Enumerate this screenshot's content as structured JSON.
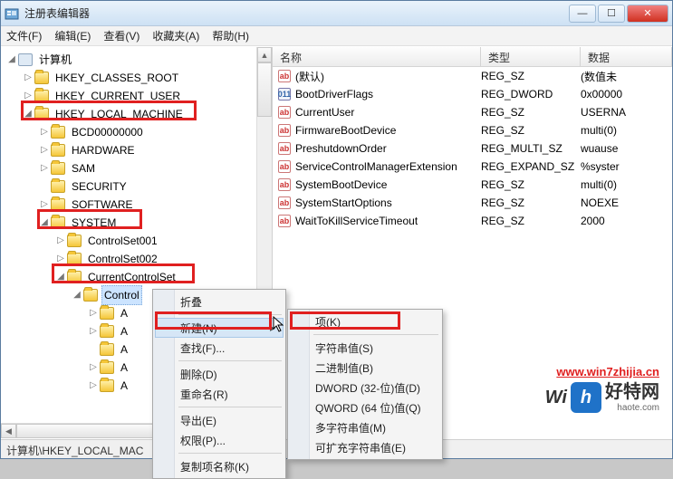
{
  "window": {
    "title": "注册表编辑器",
    "blurred_extra": ""
  },
  "winbuttons": {
    "min": "—",
    "max": "☐",
    "close": "✕"
  },
  "menubar": [
    "文件(F)",
    "编辑(E)",
    "查看(V)",
    "收藏夹(A)",
    "帮助(H)"
  ],
  "tree": {
    "root": "计算机",
    "hkcr": "HKEY_CLASSES_ROOT",
    "hkcu": "HKEY_CURRENT_USER",
    "hklm": "HKEY_LOCAL_MACHINE",
    "bcd": "BCD00000000",
    "hardware": "HARDWARE",
    "sam": "SAM",
    "security": "SECURITY",
    "software": "SOFTWARE",
    "system": "SYSTEM",
    "cs1": "ControlSet001",
    "cs2": "ControlSet002",
    "ccs": "CurrentControlSet",
    "control": "Control",
    "a1": "A",
    "a2": "A",
    "a3": "A",
    "a4": "A",
    "a5": "A"
  },
  "list": {
    "headers": {
      "name": "名称",
      "type": "类型",
      "data": "数据"
    },
    "rows": [
      {
        "icon": "str",
        "name": "(默认)",
        "type": "REG_SZ",
        "data": "(数值未"
      },
      {
        "icon": "bin",
        "name": "BootDriverFlags",
        "type": "REG_DWORD",
        "data": "0x00000"
      },
      {
        "icon": "str",
        "name": "CurrentUser",
        "type": "REG_SZ",
        "data": "USERNA"
      },
      {
        "icon": "str",
        "name": "FirmwareBootDevice",
        "type": "REG_SZ",
        "data": "multi(0)"
      },
      {
        "icon": "str",
        "name": "PreshutdownOrder",
        "type": "REG_MULTI_SZ",
        "data": "wuause"
      },
      {
        "icon": "str",
        "name": "ServiceControlManagerExtension",
        "type": "REG_EXPAND_SZ",
        "data": "%syster"
      },
      {
        "icon": "str",
        "name": "SystemBootDevice",
        "type": "REG_SZ",
        "data": "multi(0)"
      },
      {
        "icon": "str",
        "name": "SystemStartOptions",
        "type": "REG_SZ",
        "data": " NOEXE"
      },
      {
        "icon": "str",
        "name": "WaitToKillServiceTimeout",
        "type": "REG_SZ",
        "data": "2000"
      }
    ]
  },
  "context_main": {
    "collapse": "折叠",
    "new": "新建(N)",
    "find": "查找(F)...",
    "delete": "删除(D)",
    "rename": "重命名(R)",
    "export": "导出(E)",
    "permissions": "权限(P)...",
    "copykey": "复制项名称(K)"
  },
  "context_sub": {
    "key": "项(K)",
    "string": "字符串值(S)",
    "binary": "二进制值(B)",
    "dword": "DWORD (32-位)值(D)",
    "qword": "QWORD (64 位)值(Q)",
    "multistring": "多字符串值(M)",
    "expandstring": "可扩充字符串值(E)"
  },
  "statusbar": "计算机\\HKEY_LOCAL_MAC",
  "watermark": {
    "url": "www.win7zhijia.cn",
    "brand": "好特网",
    "brand_sub": "haote.com",
    "logo_letter": "h"
  }
}
